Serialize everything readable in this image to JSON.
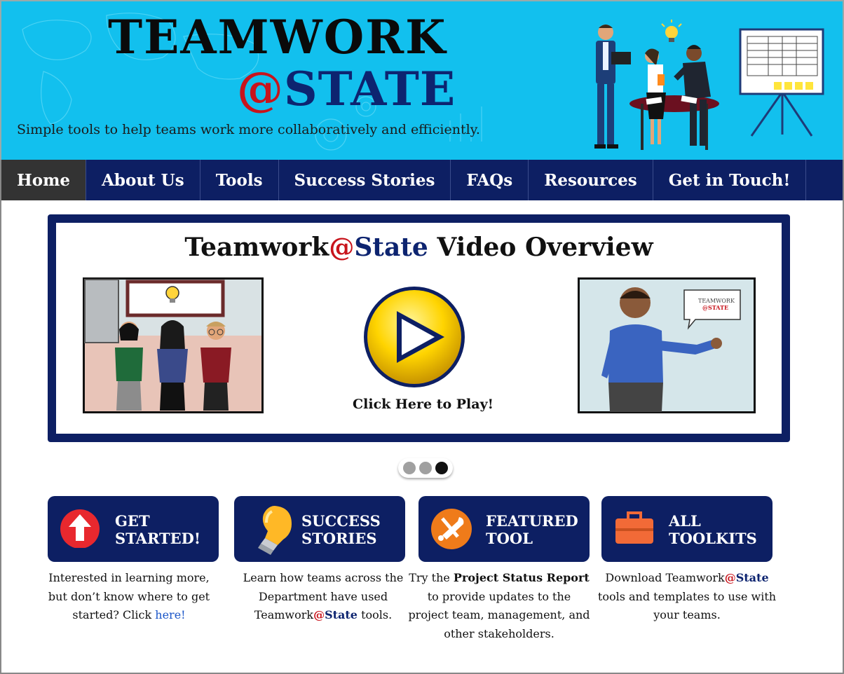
{
  "header": {
    "logo_line1": "TEAMWORK",
    "logo_at": "@",
    "logo_state": "STATE",
    "tagline": "Simple tools to help teams work more collaboratively and efficiently."
  },
  "nav": {
    "items": [
      "Home",
      "About Us",
      "Tools",
      "Success Stories",
      "FAQs",
      "Resources",
      "Get in Touch!"
    ],
    "active": "Home"
  },
  "slider": {
    "title_part1": "Teamwork",
    "title_at": "@",
    "title_state": "State",
    "title_part2": " Video Overview",
    "play_label": "Click Here to Play!",
    "bubble_line1": "TEAMWORK",
    "bubble_line2": "@STATE",
    "slide_count": 3,
    "active_slide": 3
  },
  "cards": [
    {
      "line1": "GET",
      "line2": "STARTED!",
      "icon": "arrow-up-icon"
    },
    {
      "line1": "SUCCESS",
      "line2": "STORIES",
      "icon": "lightbulb-icon"
    },
    {
      "line1": "FEATURED",
      "line2": "TOOL",
      "icon": "tools-icon"
    },
    {
      "line1": "ALL",
      "line2": "TOOLKITS",
      "icon": "toolbox-icon"
    }
  ],
  "descriptions": {
    "get_started_text": "Interested in learning more, but don’t know where to get started? Click ",
    "get_started_link": "here!",
    "success_pre": "Learn how teams across the Department have used Teamwork",
    "success_at": "@",
    "success_state": "State",
    "success_post": " tools.",
    "featured_pre": "Try the ",
    "featured_bold": "Project Status Report",
    "featured_post": " to provide updates to the project team, management, and other stakeholders.",
    "toolkits_pre": "Download Teamwork",
    "toolkits_at": "@",
    "toolkits_state": "State",
    "toolkits_post": " tools and templates to use with your teams."
  },
  "colors": {
    "header_bg": "#12c0ee",
    "navy": "#0d1f63",
    "accent_red": "#c8141c",
    "link_blue": "#1a55c8",
    "active_nav": "#333333"
  }
}
